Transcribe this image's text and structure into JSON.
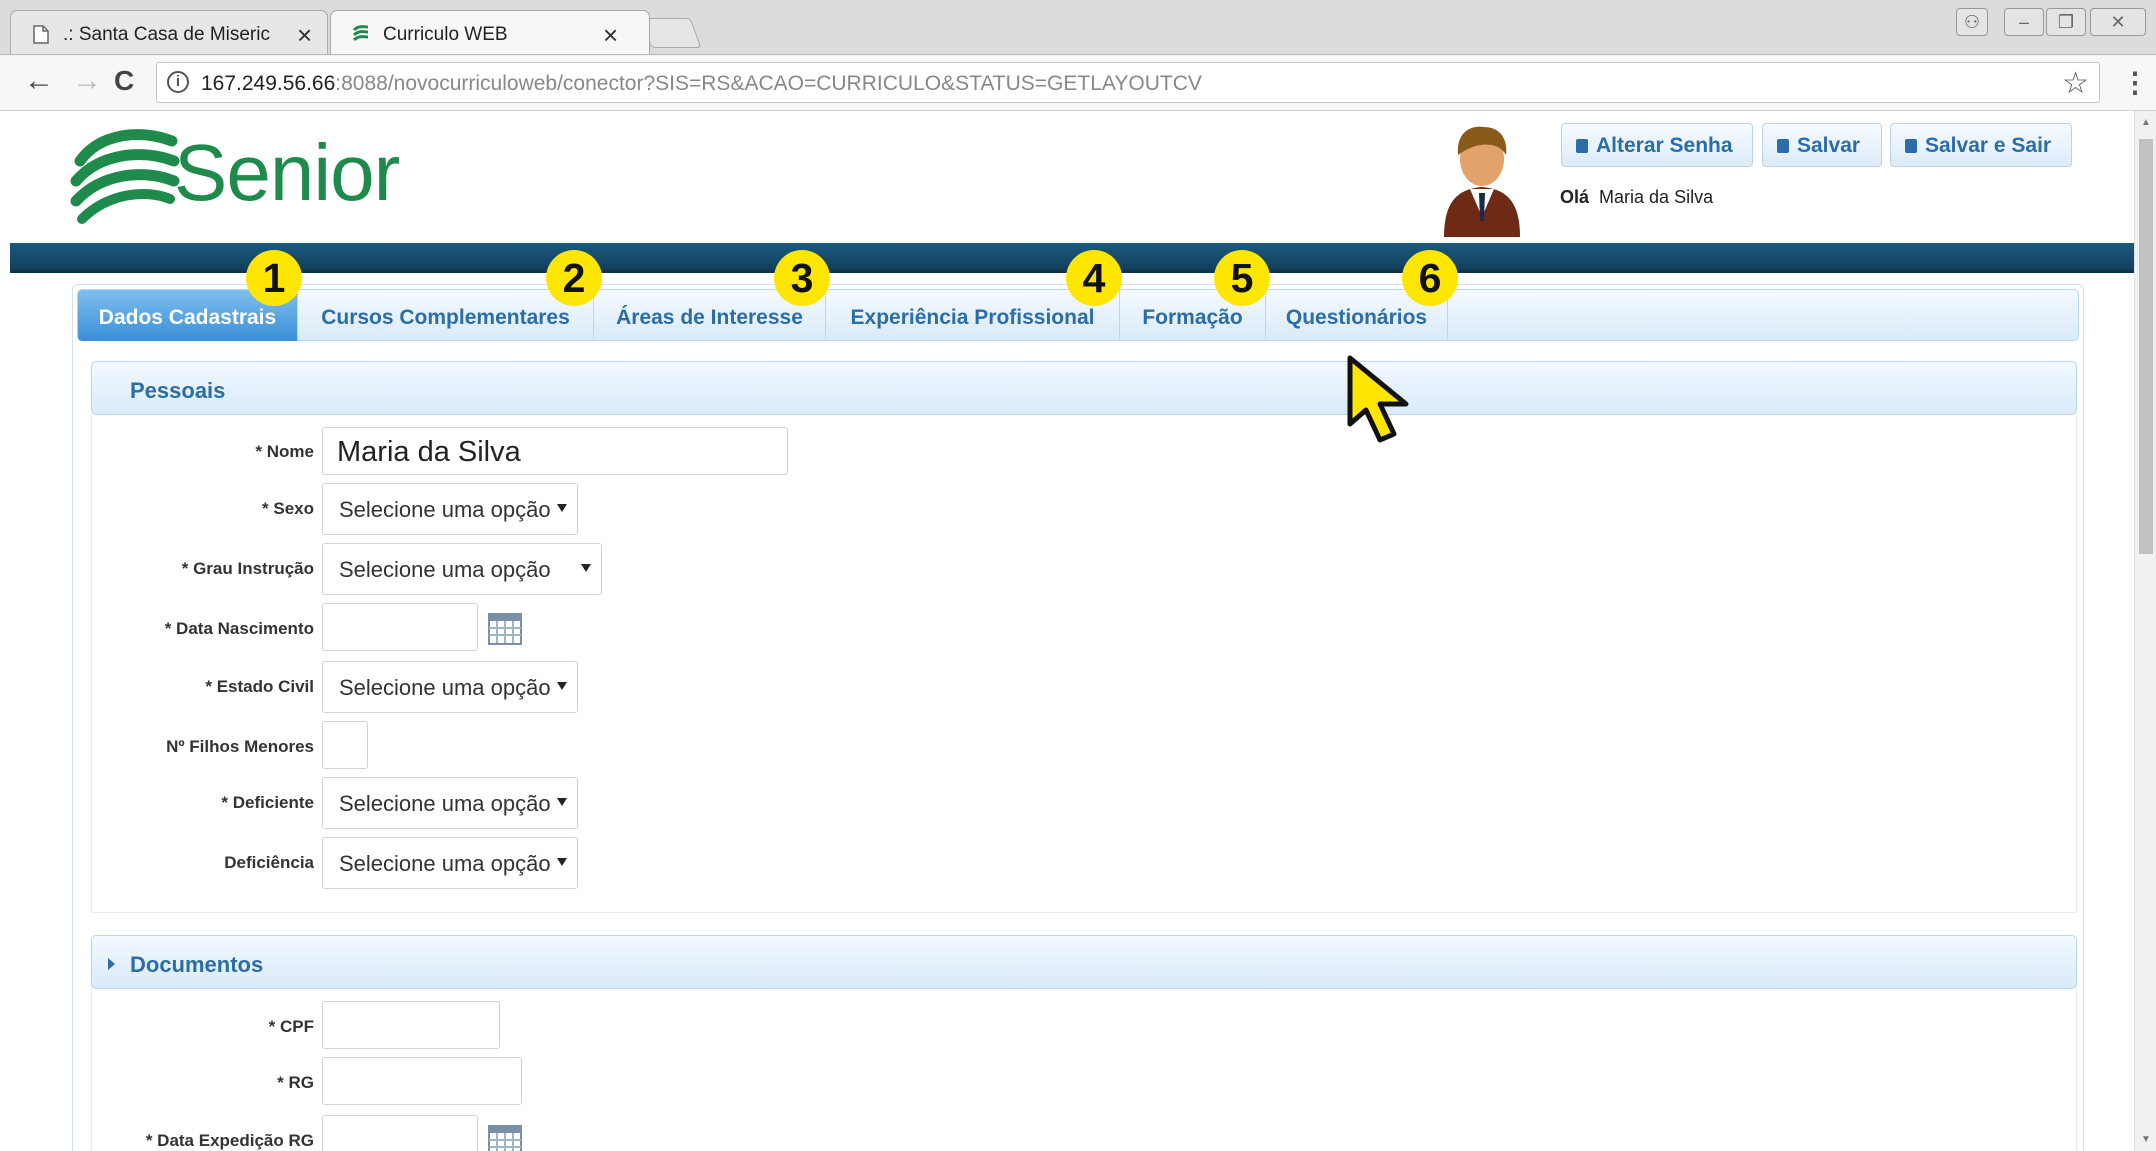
{
  "browser": {
    "tabs": [
      {
        "title": ".: Santa Casa de Miseric",
        "close": "×"
      },
      {
        "title": "Curriculo WEB",
        "close": "×"
      }
    ],
    "window_controls": {
      "profile": "⚇",
      "minimize": "–",
      "restore": "❐",
      "close": "✕"
    },
    "nav": {
      "back": "←",
      "forward": "→",
      "reload": "C"
    },
    "url_host": "167.249.56.66",
    "url_rest": ":8088/novocurriculoweb/conector?SIS=RS&ACAO=CURRICULO&STATUS=GETLAYOUTCV",
    "info_icon": "i",
    "star": "☆",
    "menu": "⋮"
  },
  "header": {
    "brand": "Senior",
    "buttons": {
      "change_password": "Alterar Senha",
      "save": "Salvar",
      "save_exit": "Salvar e Sair"
    },
    "greeting_label": "Olá",
    "user_name": "Maria da Silva"
  },
  "tabs": [
    {
      "label": "Dados Cadastrais",
      "number": "1"
    },
    {
      "label": "Cursos Complementares",
      "number": "2"
    },
    {
      "label": "Áreas de Interesse",
      "number": "3"
    },
    {
      "label": "Experiência Profissional",
      "number": "4"
    },
    {
      "label": "Formação",
      "number": "5"
    },
    {
      "label": "Questionários",
      "number": "6"
    }
  ],
  "sections": {
    "pessoais": {
      "title": "Pessoais",
      "fields": {
        "nome": {
          "label": "* Nome",
          "value": "Maria da Silva"
        },
        "sexo": {
          "label": "* Sexo",
          "value": "Selecione uma opção"
        },
        "grau": {
          "label": "* Grau Instrução",
          "value": "Selecione uma opção"
        },
        "nasc": {
          "label": "* Data Nascimento",
          "value": ""
        },
        "civil": {
          "label": "* Estado Civil",
          "value": "Selecione uma opção"
        },
        "filhos": {
          "label": "Nº Filhos Menores",
          "value": ""
        },
        "defic": {
          "label": "* Deficiente",
          "value": "Selecione uma opção"
        },
        "deficiencia": {
          "label": "Deficiência",
          "value": "Selecione uma opção"
        }
      }
    },
    "documentos": {
      "title": "Documentos",
      "fields": {
        "cpf": {
          "label": "* CPF",
          "value": ""
        },
        "rg": {
          "label": "* RG",
          "value": ""
        },
        "exp": {
          "label": "* Data Expedição RG",
          "value": ""
        }
      }
    }
  },
  "colors": {
    "accent": "#2b6da8",
    "brand_green": "#1e8a4c",
    "band": "#14425f",
    "marker": "#ffe600"
  }
}
